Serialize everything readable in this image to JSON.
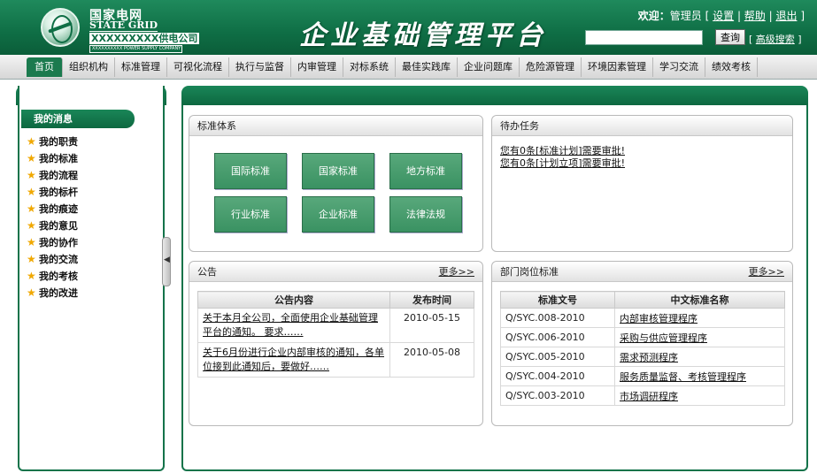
{
  "header": {
    "logo_cn": "国家电网",
    "logo_en": "STATE GRID",
    "logo_company": "XXXXXXXXX供电公司",
    "logo_sub": "XXXXXXXXXX POWER SUPPLY COMPANY",
    "title": "企业基础管理平台",
    "welcome_label": "欢迎：",
    "user": "管理员",
    "link_settings": "设置",
    "link_help": "帮助",
    "link_logout": "退出",
    "search_value": "",
    "search_button": "查询",
    "adv_search": "高级搜索"
  },
  "nav": {
    "items": [
      "首页",
      "组织机构",
      "标准管理",
      "可视化流程",
      "执行与监督",
      "内审管理",
      "对标系统",
      "最佳实践库",
      "企业问题库",
      "危险源管理",
      "环境因素管理",
      "学习交流",
      "绩效考核"
    ]
  },
  "sidebar": {
    "heading": "我的消息",
    "items": [
      "我的职责",
      "我的标准",
      "我的流程",
      "我的标杆",
      "我的痕迹",
      "我的意见",
      "我的协作",
      "我的交流",
      "我的考核",
      "我的改进"
    ]
  },
  "standards": {
    "title": "标准体系",
    "buttons": [
      "国际标准",
      "国家标准",
      "地方标准",
      "行业标准",
      "企业标准",
      "法律法规"
    ]
  },
  "todo": {
    "title": "待办任务",
    "items": [
      "您有0条[标准计划]需要审批!",
      "您有0条[计划立项]需要审批!"
    ]
  },
  "notice": {
    "title": "公告",
    "more": "更多>>",
    "col_content": "公告内容",
    "col_time": "发布时间",
    "rows": [
      {
        "content": "关于本月全公司，全面使用企业基础管理平台的通知。 要求……",
        "time": "2010-05-15"
      },
      {
        "content": "关于6月份进行企业内部审核的通知，各单位接到此通知后，要做好……",
        "time": "2010-05-08"
      }
    ]
  },
  "dept": {
    "title": "部门岗位标准",
    "more": "更多>>",
    "col_code": "标准文号",
    "col_name": "中文标准名称",
    "rows": [
      {
        "code": "Q/SYC.008-2010",
        "name": "内部审核管理程序"
      },
      {
        "code": "Q/SYC.006-2010",
        "name": "采购与供应管理程序"
      },
      {
        "code": "Q/SYC.005-2010",
        "name": "需求预测程序"
      },
      {
        "code": "Q/SYC.004-2010",
        "name": "服务质量监督、考核管理程序"
      },
      {
        "code": "Q/SYC.003-2010",
        "name": "市场调研程序"
      }
    ]
  }
}
